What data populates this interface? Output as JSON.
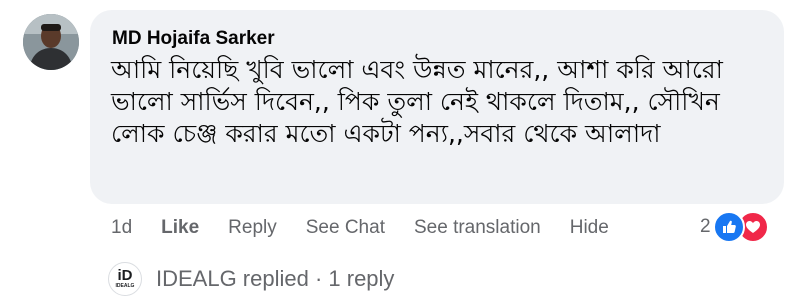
{
  "comment": {
    "author": "MD Hojaifa Sarker",
    "text": "আমি নিয়েছি খুবি ভালো এবং উন্নত মানের,, আশা করি আরো ভালো সার্ভিস দিবেন,, পিক তুলা নেই থাকলে দিতাম,, সৌখিন লোক চেঞ্জ করার মতো একটা পন্য,,সবার থেকে আলাদা",
    "time": "1d"
  },
  "actions": {
    "like_label": "Like",
    "reply_label": "Reply",
    "see_chat_label": "See Chat",
    "see_translation_label": "See translation",
    "hide_label": "Hide"
  },
  "reactions": {
    "count": "2",
    "icons": [
      "like-icon",
      "love-icon"
    ],
    "colors": {
      "like": "#1877f2",
      "love": "#f02849"
    }
  },
  "replies": {
    "avatar_logo": "iD",
    "avatar_logo_sub": "IDEALG",
    "summary": "IDEALG replied · 1 reply"
  },
  "colors": {
    "bubble": "#f0f2f5",
    "text": "#050505",
    "secondary_text": "#65676b"
  }
}
